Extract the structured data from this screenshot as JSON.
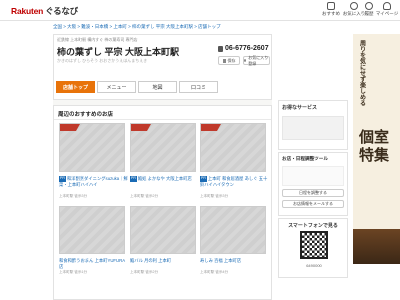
{
  "header": {
    "logo_rakuten": "Rakuten",
    "logo_gurunavi": "ぐるなび",
    "nav": [
      {
        "label": "おすすめ",
        "icon": "star-icon"
      },
      {
        "label": "お気に入り",
        "icon": "heart-icon"
      },
      {
        "label": "履歴",
        "icon": "clock-icon"
      },
      {
        "label": "マイページ",
        "icon": "user-icon"
      }
    ]
  },
  "breadcrumb": "全国 > 大阪 > 難波・日本橋 > 上本町 > 柿の葉ずし 平宗 大阪上本町駅 > 店舗トップ",
  "shop": {
    "tagline": "近鉄線 上本町駅 構内すぐ 柿の葉寿司 専門店",
    "name": "柿の葉ずし 平宗 大阪上本町駅",
    "subtitle": "かきのはずし ひらそう おおさかうえほんまちえき",
    "phone": "06-6776-2607",
    "save_label": "保存",
    "share_label": "お気に入り登録"
  },
  "tabs": [
    "店舗トップ",
    "メニュー",
    "地図",
    "口コミ"
  ],
  "nearby": {
    "title": "周辺のおすすめのお店",
    "items": [
      {
        "badge": "PR",
        "title": "和洋割烹ダイニングsuzuka｜鮮菜・上本町ハイハイ",
        "meta": "上本町駅 徒歩3分"
      },
      {
        "badge": "PR",
        "title": "鮨処 よかなや 大阪上本町店",
        "meta": "上本町駅 徒歩2分"
      },
      {
        "badge": "PR",
        "title": "上本町 和食居酒屋 あしぐ 五十鈴ハイハイタウン",
        "meta": "上本町駅 徒歩3分"
      },
      {
        "badge": "",
        "title": "和食和酢うおまん 上本町YUFURA店",
        "meta": "上本町駅 徒歩1分"
      },
      {
        "badge": "",
        "title": "鮨バル 月の利 上本町",
        "meta": "上本町駅 徒歩2分"
      },
      {
        "badge": "",
        "title": "寿しみ 百福 上本町店",
        "meta": "上本町駅 徒歩4分"
      }
    ]
  },
  "sidebar": {
    "service_title": "お得なサービス",
    "tool_title": "お店・日程調整ツール",
    "tool_button": "日程を調整する",
    "mail_button": "お店情報をメールする",
    "smartphone_title": "スマートフォンで見る",
    "qr_caption": "6490000"
  },
  "ad": {
    "vertical_text": "周りを気にせず楽しめる",
    "big_text": "個室特集"
  },
  "colors": {
    "accent": "#e8730a",
    "brand": "#bf0000",
    "link": "#1a6bb5"
  }
}
